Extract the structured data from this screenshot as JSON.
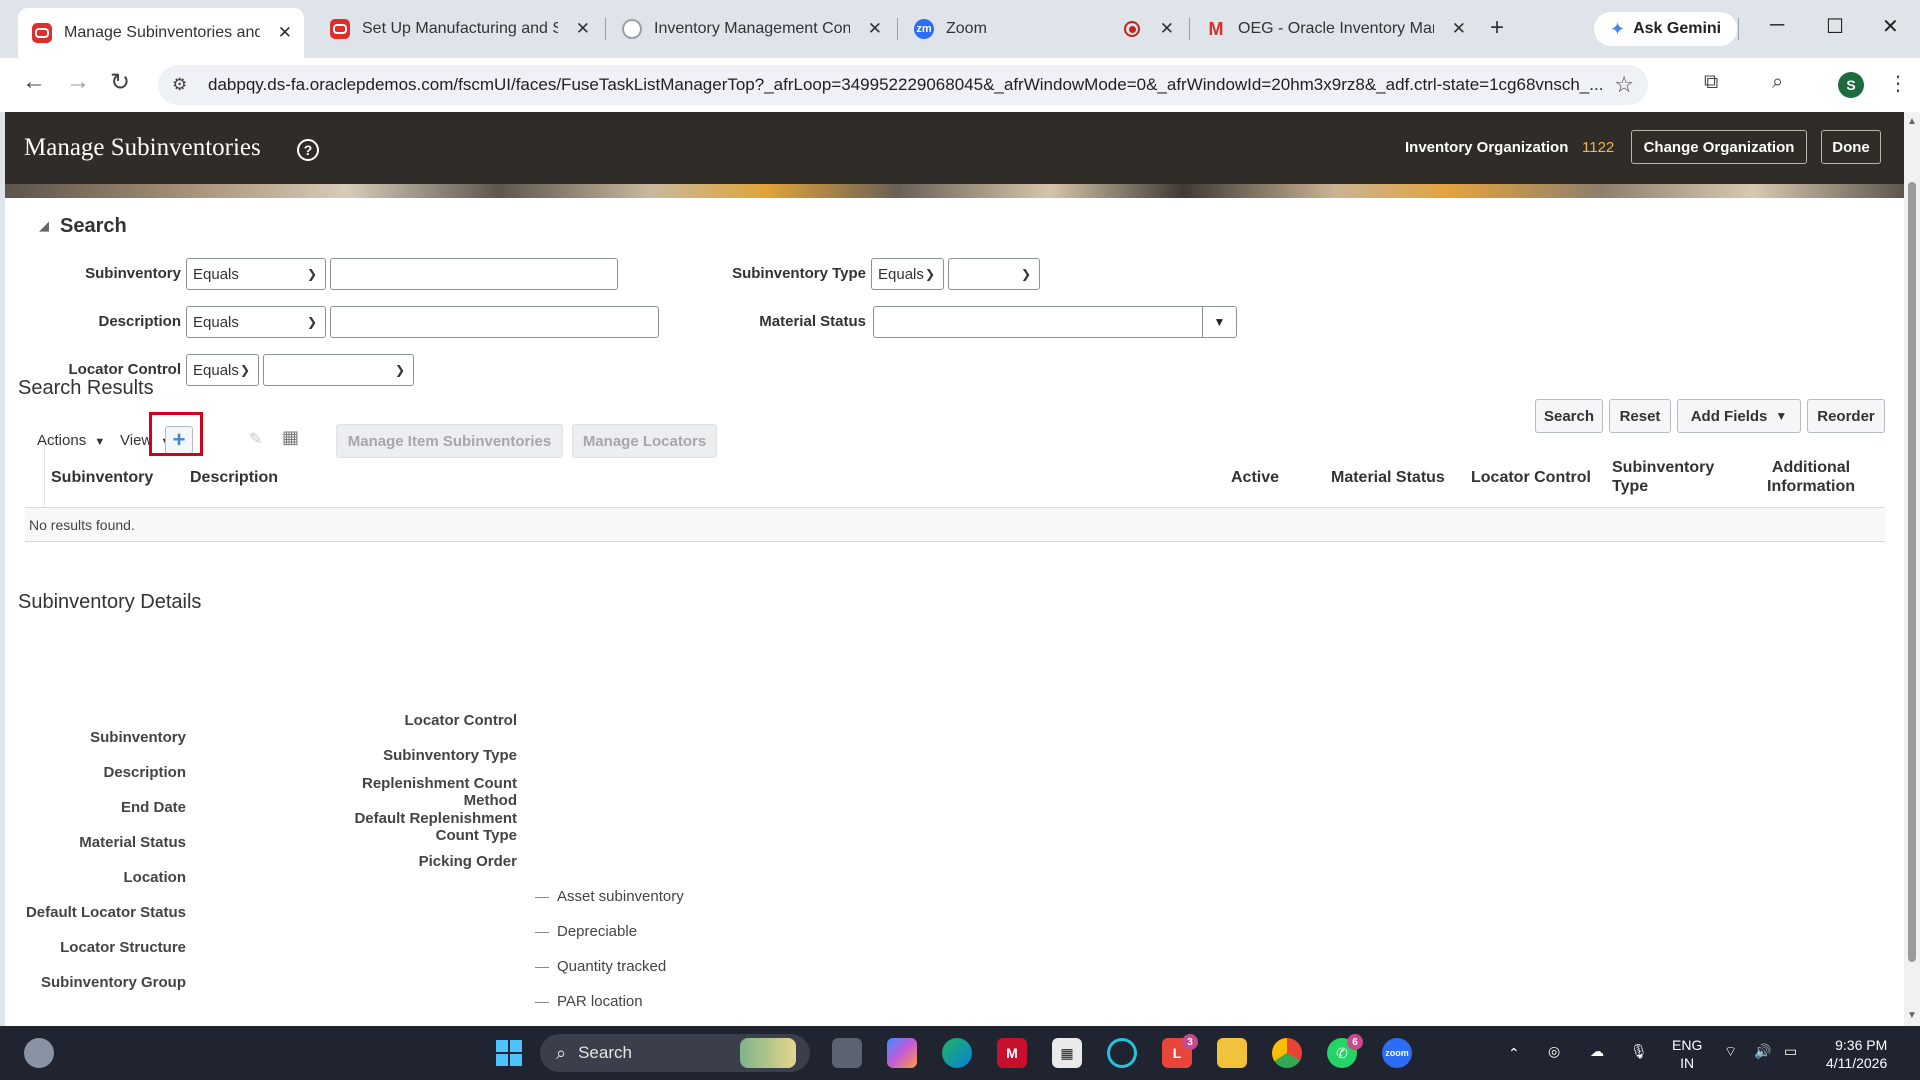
{
  "browser": {
    "tabs": [
      {
        "title": "Manage Subinventories and Lo",
        "favicon": "oracle-icon",
        "active": true
      },
      {
        "title": "Set Up Manufacturing and Sup",
        "favicon": "oracle-icon",
        "active": false
      },
      {
        "title": "Inventory Management Config",
        "favicon": "globe-icon",
        "active": false
      },
      {
        "title": "Zoom",
        "favicon": "zoom-icon",
        "active": false
      },
      {
        "title": "OEG - Oracle Inventory Manag",
        "favicon": "gmail-icon",
        "active": false
      }
    ],
    "gemini_label": "Ask Gemini",
    "url": "dabpqy.ds-fa.oraclepdemos.com/fscmUI/faces/FuseTaskListManagerTop?_afrLoop=349952229068045&_afrWindowMode=0&_afrWindowId=20hm3x9rz8&_adf.ctrl-state=1cg68vnsch_...",
    "profile_initial": "S"
  },
  "header": {
    "title": "Manage Subinventories",
    "org_label": "Inventory Organization",
    "org_value": "1122",
    "change_org_label": "Change Organization",
    "done_label": "Done"
  },
  "search": {
    "title": "Search",
    "subinventory_label": "Subinventory",
    "subinventory_op": "Equals",
    "description_label": "Description",
    "description_op": "Equals",
    "locator_control_label": "Locator Control",
    "locator_control_op": "Equals",
    "subinventory_type_label": "Subinventory Type",
    "subinventory_type_op": "Equals",
    "material_status_label": "Material Status",
    "buttons": {
      "search": "Search",
      "reset": "Reset",
      "add_fields": "Add Fields",
      "reorder": "Reorder"
    }
  },
  "results": {
    "title": "Search Results",
    "actions_label": "Actions",
    "view_label": "View",
    "manage_item_sub_label": "Manage Item Subinventories",
    "manage_locators_label": "Manage Locators",
    "columns": {
      "subinventory": "Subinventory",
      "description": "Description",
      "active": "Active",
      "material_status": "Material Status",
      "locator_control": "Locator Control",
      "subinventory_type_1": "Subinventory",
      "subinventory_type_2": "Type",
      "additional_info_1": "Additional",
      "additional_info_2": "Information"
    },
    "empty_message": "No results found."
  },
  "details": {
    "title": "Subinventory Details",
    "left_labels": [
      "Subinventory",
      "Description",
      "End Date",
      "Material Status",
      "Location",
      "Default Locator Status",
      "Locator Structure",
      "Subinventory Group"
    ],
    "mid_labels": {
      "locator_control": "Locator Control",
      "subinventory_type": "Subinventory Type",
      "replenishment_1": "Replenishment Count",
      "replenishment_2": "Method",
      "default_repl_1": "Default Replenishment",
      "default_repl_2": "Count Type",
      "picking_order": "Picking Order"
    },
    "checks": [
      "Asset subinventory",
      "Depreciable",
      "Quantity tracked",
      "PAR location"
    ]
  },
  "taskbar": {
    "search_label": "Search",
    "lang_1": "ENG",
    "lang_2": "IN",
    "time": "9:36 PM",
    "date": "4/11/2026",
    "badge_l": "3",
    "badge_whatsapp": "6"
  }
}
